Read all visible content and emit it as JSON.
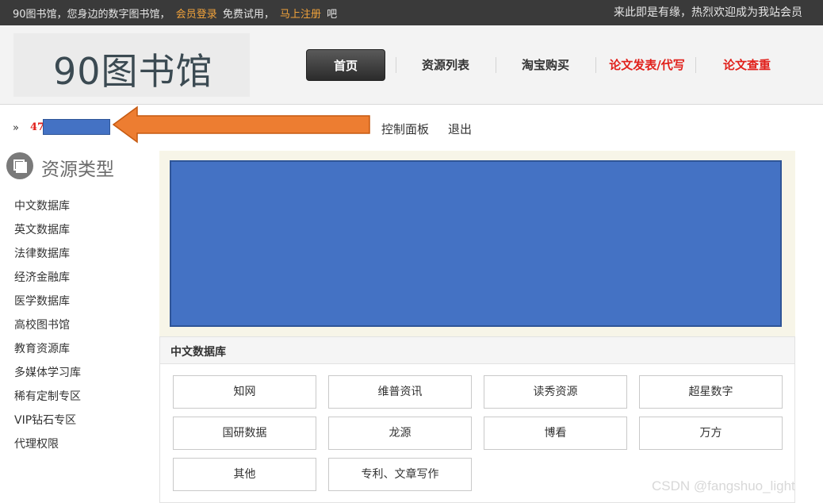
{
  "topbar": {
    "welcome_prefix": "90图书馆，您身边的数字图书馆，",
    "login_link": "会员登录",
    "trial_text": "免费试用，",
    "register_link": "马上注册",
    "suffix": "吧",
    "right_text": "来此即是有缘，热烈欢迎成为我站会员"
  },
  "header": {
    "logo": "90图书馆",
    "nav": [
      {
        "label": "首页"
      },
      {
        "label": "资源列表"
      },
      {
        "label": "淘宝购买"
      },
      {
        "label": "论文发表/代写"
      },
      {
        "label": "论文查重"
      }
    ]
  },
  "user": {
    "raquo": "»",
    "id_prefix": "47",
    "control_panel": "控制面板",
    "logout": "退出"
  },
  "sidebar": {
    "title": "资源类型",
    "items": [
      {
        "label": "中文数据库"
      },
      {
        "label": "英文数据库"
      },
      {
        "label": "法律数据库"
      },
      {
        "label": "经济金融库"
      },
      {
        "label": "医学数据库"
      },
      {
        "label": "高校图书馆"
      },
      {
        "label": "教育资源库"
      },
      {
        "label": "多媒体学习库"
      },
      {
        "label": "稀有定制专区"
      },
      {
        "label": "VIP钻石专区"
      },
      {
        "label": "代理权限"
      }
    ]
  },
  "section": {
    "title": "中文数据库",
    "buttons": [
      {
        "label": "知网"
      },
      {
        "label": "维普资讯"
      },
      {
        "label": "读秀资源"
      },
      {
        "label": "超星数字"
      },
      {
        "label": "国研数据"
      },
      {
        "label": "龙源"
      },
      {
        "label": "博看"
      },
      {
        "label": "万方"
      },
      {
        "label": "其他"
      },
      {
        "label": "专利、文章写作"
      }
    ]
  },
  "colors": {
    "accent_orange": "#f2a33a",
    "nav_red": "#e1201b",
    "mask_blue": "#4472c4",
    "arrow_orange": "#ed7d31"
  },
  "watermark": "CSDN @fangshuo_light"
}
